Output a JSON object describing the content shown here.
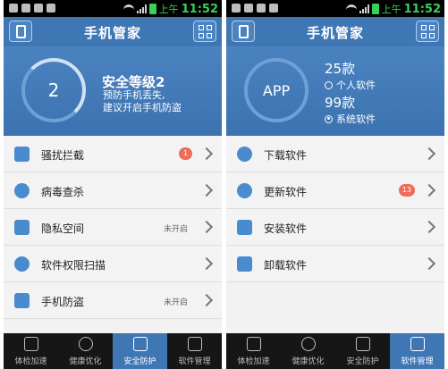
{
  "status_bar": {
    "ampm": "上午",
    "time": "11:52"
  },
  "left_screen": {
    "title": "手机管家",
    "security": {
      "ring_value": "2",
      "title": "安全等级2",
      "desc_line1": "预防手机丢失,",
      "desc_line2": "建议开启手机防盗"
    },
    "menu": [
      {
        "label": "骚扰拦截",
        "badge": "1",
        "status": ""
      },
      {
        "label": "病毒查杀",
        "badge": "",
        "status": ""
      },
      {
        "label": "隐私空间",
        "badge": "",
        "status": "未开启"
      },
      {
        "label": "软件权限扫描",
        "badge": "",
        "status": ""
      },
      {
        "label": "手机防盗",
        "badge": "",
        "status": "未开启"
      }
    ],
    "tabs": [
      {
        "label": "体检加速",
        "active": false
      },
      {
        "label": "健康优化",
        "active": false
      },
      {
        "label": "安全防护",
        "active": true
      },
      {
        "label": "软件管理",
        "active": false
      }
    ]
  },
  "right_screen": {
    "title": "手机管家",
    "apps": {
      "ring_label": "APP",
      "personal_count": "25款",
      "personal_label": "个人软件",
      "system_count": "99款",
      "system_label": "系统软件",
      "selected": "系统软件"
    },
    "menu": [
      {
        "label": "下载软件",
        "badge": ""
      },
      {
        "label": "更新软件",
        "badge": "13"
      },
      {
        "label": "安装软件",
        "badge": ""
      },
      {
        "label": "卸载软件",
        "badge": ""
      }
    ],
    "tabs": [
      {
        "label": "体检加速",
        "active": false
      },
      {
        "label": "健康优化",
        "active": false
      },
      {
        "label": "安全防护",
        "active": false
      },
      {
        "label": "软件管理",
        "active": true
      }
    ]
  },
  "colors": {
    "header_blue": "#3f77b5",
    "badge_red": "#ef6c57",
    "time_green": "#35d15b"
  }
}
